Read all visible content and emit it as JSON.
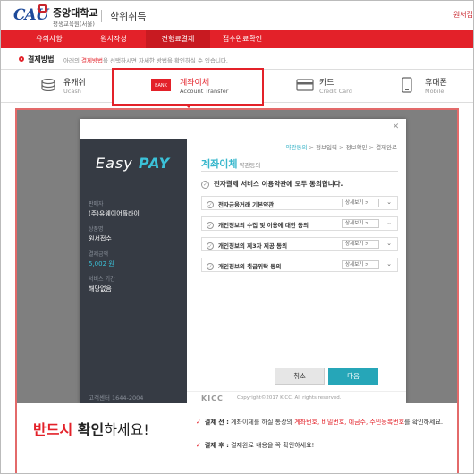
{
  "header": {
    "logo_mark": "CAU",
    "university": "중앙대학교",
    "sub": "평생교육원(서울)",
    "title": "학위취득",
    "right_link": "원서접"
  },
  "nav": {
    "items": [
      "유의사항",
      "원서작성",
      "전형료결제",
      "접수완료확인"
    ]
  },
  "method": {
    "label": "결제방법",
    "desc_pre": "아래의",
    "desc_hl": "결제방법",
    "desc_post": "을 선택하시면 자세한 방법을 확인하실 수 있습니다."
  },
  "payment_tabs": [
    {
      "label": "유캐쉬",
      "sub": "Ucash",
      "icon": "coins-icon"
    },
    {
      "label": "계좌이체",
      "sub": "Account Transfer",
      "icon": "bank-card-icon",
      "icon_text": "BANK"
    },
    {
      "label": "카드",
      "sub": "Credit Card",
      "icon": "credit-card-icon"
    },
    {
      "label": "휴대폰",
      "sub": "Mobile",
      "icon": "mobile-phone-icon"
    }
  ],
  "modal": {
    "brand_easy": "Easy",
    "brand_pay": "PAY",
    "seller_label": "판매자",
    "seller": "(주)유웨이어플라이",
    "product_label": "상품명",
    "product": "원서접수",
    "amount_label": "결제금액",
    "amount": "5,002 원",
    "period_label": "서비스 기간",
    "period": "해당없음",
    "side_footer": "고객센터 1644-2004",
    "steps": [
      "약관동의",
      "정보입력",
      "정보확인",
      "결제완료"
    ],
    "title": "계좌이체",
    "title_small": "약관동의",
    "agree_all": "전자결제 서비스 이용약관에 모두 동의합니다.",
    "terms": [
      {
        "label": "전자금융거래 기본약관",
        "more": "상세보기 >"
      },
      {
        "label": "개인정보의 수집 및 이용에 대한 동의",
        "more": "상세보기 >"
      },
      {
        "label": "개인정보의 제3자 제공 동의",
        "more": "상세보기 >"
      },
      {
        "label": "개인정보의 취급위탁 동의",
        "more": "상세보기 >"
      }
    ],
    "cancel": "취소",
    "next": "다음",
    "footer_logo": "KICC",
    "footer_copy": "Copyright©2017 KICC. All rights reserved."
  },
  "notice": {
    "big_red": "반드시",
    "big_bold": "확인",
    "big_norm": "하세요!",
    "n1_key": "결제 전 :",
    "n1_pre": "계좌이체를 하실 통장의",
    "n1_red": "계좌번호, 비밀번호, 예금주, 주민등록번호",
    "n1_post": "를 확인하세요.",
    "n2_key": "결제 후 :",
    "n2_text": "결제완료 내용을 꼭 확인하세요!"
  },
  "colors": {
    "brand_red": "#e32129",
    "teal": "#26a6b8",
    "sidebar": "#363b44"
  }
}
